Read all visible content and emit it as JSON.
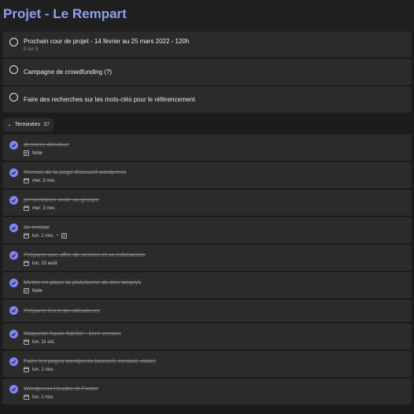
{
  "app": {
    "title": "Projet - Le Rempart"
  },
  "open_tasks": [
    {
      "label": "Prochain cour de projet - 14 février au 25 mars 2022 - 120h",
      "sub": "0 sur 5"
    },
    {
      "label": "Campagne de crowdfunding (?)"
    },
    {
      "label": "Faire des recherches sur les mots-clés pour le référencement"
    }
  ],
  "completed_group": {
    "label": "Terminées",
    "count": "37"
  },
  "completed_tasks": [
    {
      "label": "derniere directive",
      "note": "Note"
    },
    {
      "label": "Remise de la page d'accueil wordpress",
      "date": "mer. 3 nov."
    },
    {
      "label": "présentation orale au groupe",
      "date": "mer. 3 nov."
    },
    {
      "label": "3e remise",
      "date": "lun. 1 nov."
    },
    {
      "label": "Préparer une offre de service et un échéancier",
      "date": "lun. 23 août"
    },
    {
      "label": "Mettre en place la plateforme de don simplyk",
      "note": "Note"
    },
    {
      "label": "Préparer les tests utilisateurs"
    },
    {
      "label": "Maquette haute fidélité - 1ere version",
      "date": "lun. 11 oct."
    },
    {
      "label": "Faire les pages wordpress (accueil, contact, visite)",
      "date": "lun. 1 nov."
    },
    {
      "label": "Wordpress Header et Footer",
      "date": "lun. 1 nov."
    }
  ],
  "icons": {
    "calendar": "calendar-icon",
    "note": "note-icon",
    "check": "check-circle-icon"
  },
  "colors": {
    "accent": "#7f85f5",
    "title": "#8ea0f0"
  }
}
